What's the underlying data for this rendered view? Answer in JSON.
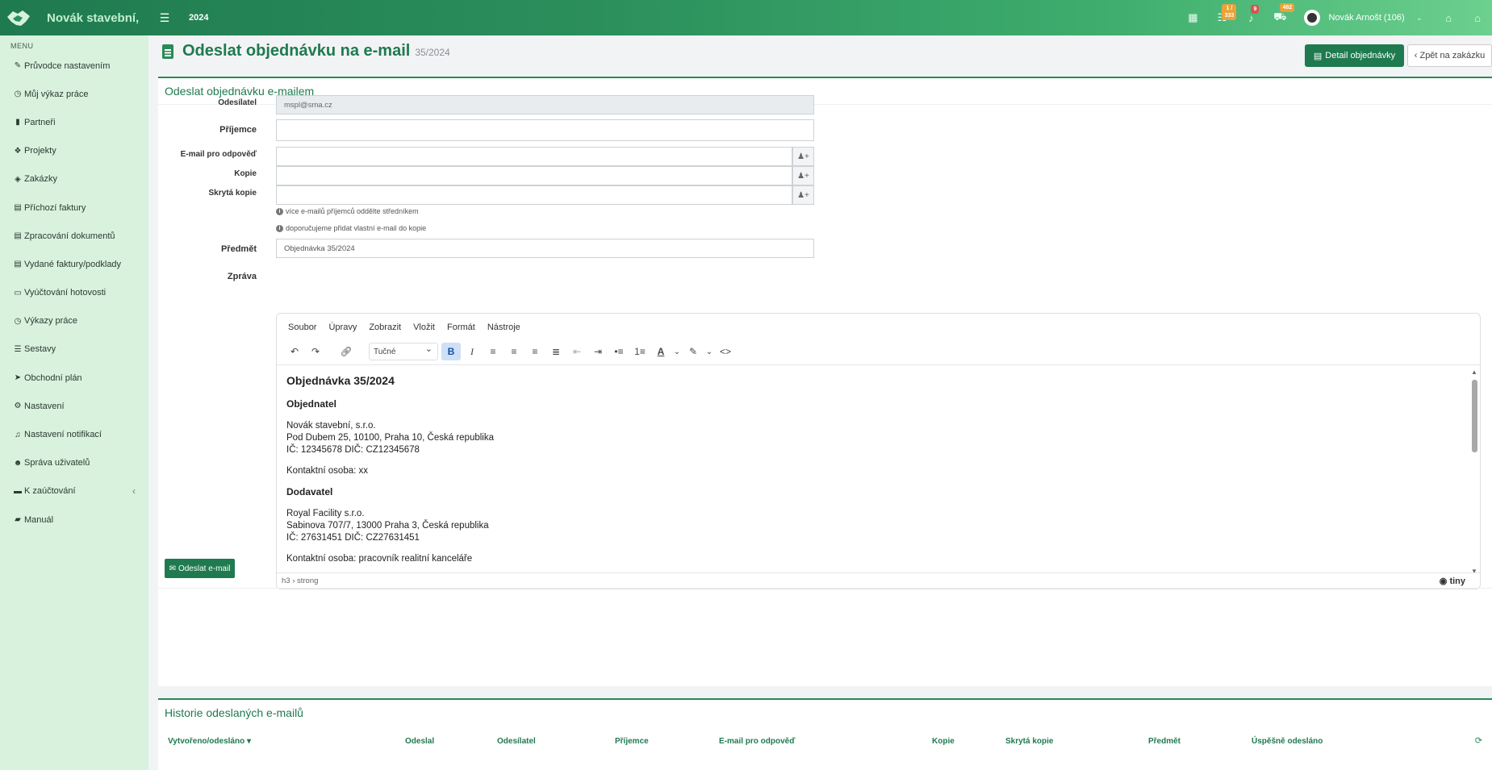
{
  "topbar": {
    "brand": "Novák stavební,",
    "menu_icon": "hamburger-icon",
    "year": "2024",
    "badges": {
      "tasks": "1 / 333",
      "notifications": "9",
      "cart": "482"
    },
    "user_name": "Novák Arnošt (106)"
  },
  "sidebar": {
    "menu_title": "MENU",
    "items": [
      {
        "label": "Průvodce nastavením",
        "icon": "pencil-icon"
      },
      {
        "label": "Můj výkaz práce",
        "icon": "clock-icon"
      },
      {
        "label": "Partneři",
        "icon": "bookmark-icon"
      },
      {
        "label": "Projekty",
        "icon": "cubes-icon"
      },
      {
        "label": "Zakázky",
        "icon": "box-icon"
      },
      {
        "label": "Příchozí faktury",
        "icon": "file-icon"
      },
      {
        "label": "Zpracování dokumentů",
        "icon": "document-icon"
      },
      {
        "label": "Vydané faktury/podklady",
        "icon": "file-export-icon"
      },
      {
        "label": "Vyúčtování hotovosti",
        "icon": "money-icon"
      },
      {
        "label": "Výkazy práce",
        "icon": "clock-icon"
      },
      {
        "label": "Sestavy",
        "icon": "list-icon"
      },
      {
        "label": "Obchodní plán",
        "icon": "send-icon"
      },
      {
        "label": "Nastavení",
        "icon": "gears-icon"
      },
      {
        "label": "Nastavení notifikací",
        "icon": "bell-icon"
      },
      {
        "label": "Správa uživatelů",
        "icon": "users-icon"
      },
      {
        "label": "K zaúčtování",
        "icon": "folder-icon"
      },
      {
        "label": "Manuál",
        "icon": "book-icon"
      }
    ]
  },
  "header": {
    "title": "Odeslat objednávku na e-mail",
    "subtitle": "35/2024",
    "detail_button": "Detail objednávky",
    "back_button": "Zpět na zakázku"
  },
  "form": {
    "panel_title": "Odeslat objednávku e-mailem",
    "sender_label": "Odesílatel",
    "sender_value": "mspl@sma.cz",
    "recipient_label": "Příjemce",
    "recipient_value": "",
    "reply_label": "E-mail pro odpověď",
    "reply_value": "",
    "cc_label": "Kopie",
    "cc_value": "",
    "bcc_label": "Skrytá kopie",
    "bcc_value": "",
    "hint1": "více e-mailů příjemců oddělte středníkem",
    "hint2": "doporučujeme přidat vlastní e-mail do kopie",
    "subject_label": "Předmět",
    "subject_value": "Objednávka 35/2024",
    "message_label": "Zpráva",
    "send_button": "Odeslat e-mail"
  },
  "editor": {
    "menu": [
      "Soubor",
      "Úpravy",
      "Zobrazit",
      "Vložit",
      "Formát",
      "Nástroje"
    ],
    "format_select": "Tučné",
    "content": {
      "heading": "Objednávka 35/2024",
      "orderer_title": "Objednatel",
      "orderer_name": "Novák stavební, s.r.o.",
      "orderer_address": "Pod Dubem 25, 10100, Praha 10, Česká republika",
      "orderer_ids": "IČ: 12345678 DIČ: CZ12345678",
      "orderer_contact": "Kontaktní osoba: xx",
      "supplier_title": "Dodavatel",
      "supplier_name": "Royal Facility s.r.o.",
      "supplier_address": "Sabinova 707/7, 13000 Praha 3, Česká republika",
      "supplier_ids": "IČ: 27631451 DIČ: CZ27631451",
      "supplier_contact": "Kontaktní osoba: pracovník realitní kanceláře"
    },
    "status_path": "h3 › strong",
    "brand": "tiny"
  },
  "history": {
    "title": "Historie odeslaných e-mailů",
    "columns": [
      "Vytvořeno/odesláno",
      "Odeslal",
      "Odesílatel",
      "Příjemce",
      "E-mail pro odpověď",
      "Kopie",
      "Skrytá kopie",
      "Předmět",
      "Úspěšně odesláno"
    ]
  },
  "colors": {
    "primary": "#1f7a4f",
    "sidebar": "#d8f2de",
    "badge_orange": "#e8a33a",
    "badge_red": "#d9534f"
  }
}
